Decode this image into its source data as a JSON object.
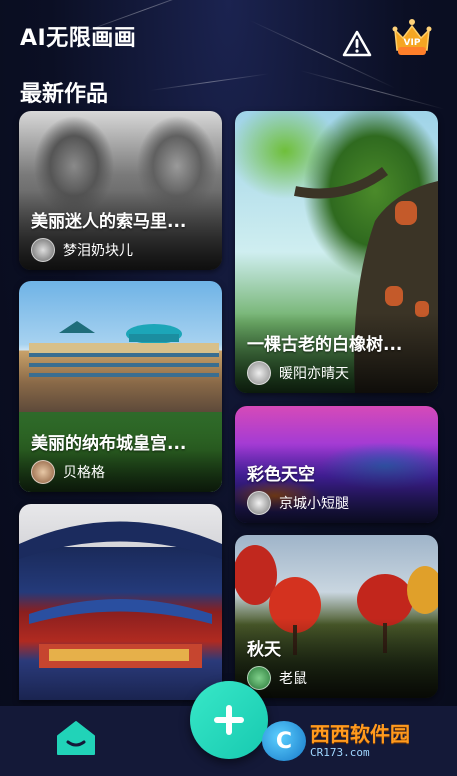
{
  "header": {
    "app_title": "AI无限画画",
    "warn_icon": "warning-icon",
    "vip_icon": "vip-crown-icon",
    "vip_label": "VIP"
  },
  "section": {
    "title": "最新作品"
  },
  "cards": [
    {
      "title": "美丽迷人的索马里...",
      "author": "梦泪奶块儿"
    },
    {
      "title": "美丽的纳布城皇宫...",
      "author": "贝格格"
    },
    {
      "title": "",
      "author": ""
    },
    {
      "title": "一棵古老的白橡树...",
      "author": "暖阳亦晴天"
    },
    {
      "title": "彩色天空",
      "author": "京城小短腿"
    },
    {
      "title": "秋天",
      "author": "老鼠"
    }
  ],
  "bottom_nav": {
    "home_icon": "home-icon",
    "add_icon": "plus-icon"
  },
  "watermark": {
    "brand": "西西软件园",
    "url": "CR173.com",
    "logo_letter": "C"
  },
  "colors": {
    "background": "#0d1126",
    "accent": "#21d3b8",
    "bottom_bar": "#141938"
  }
}
